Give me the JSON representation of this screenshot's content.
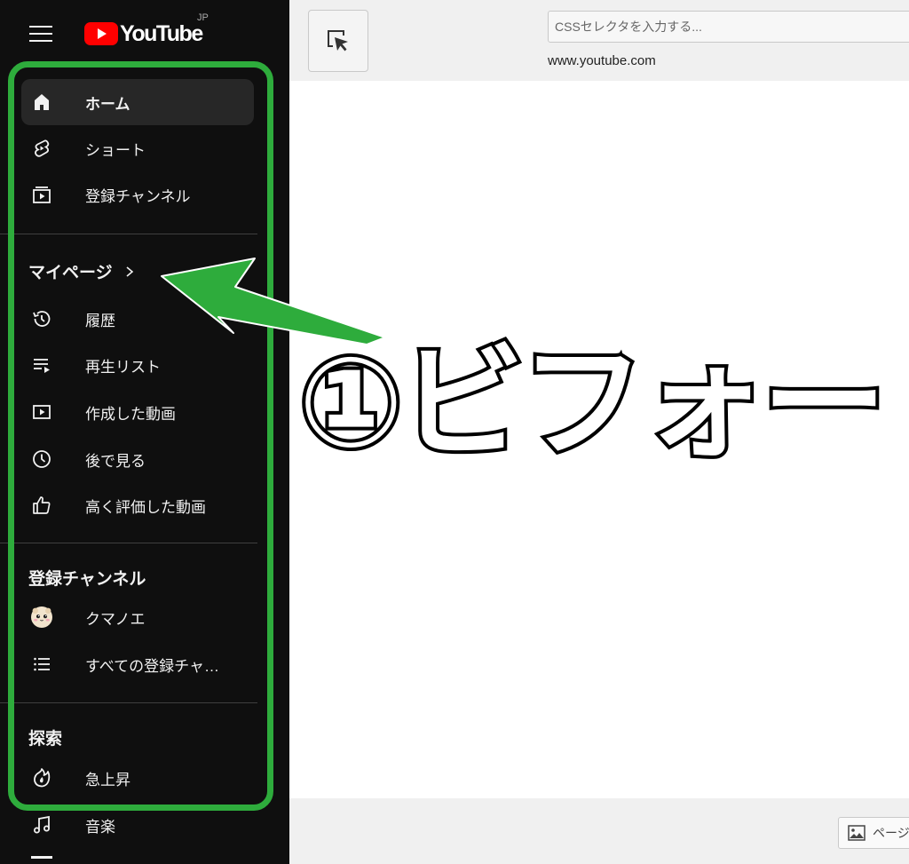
{
  "sidebar": {
    "logo_text": "YouTube",
    "region": "JP",
    "items_main": [
      {
        "label": "ホーム",
        "icon": "home-icon"
      },
      {
        "label": "ショート",
        "icon": "shorts-icon"
      },
      {
        "label": "登録チャンネル",
        "icon": "subscriptions-icon"
      }
    ],
    "mypage_title": "マイページ",
    "items_you": [
      {
        "label": "履歴",
        "icon": "history-icon"
      },
      {
        "label": "再生リスト",
        "icon": "playlist-icon"
      },
      {
        "label": "作成した動画",
        "icon": "your-videos-icon"
      },
      {
        "label": "後で見る",
        "icon": "watch-later-icon"
      },
      {
        "label": "高く評価した動画",
        "icon": "liked-icon"
      }
    ],
    "subscriptions_title": "登録チャンネル",
    "subscriptions": [
      {
        "label": "クマノエ",
        "icon": "channel-avatar"
      },
      {
        "label": "すべての登録チャ…",
        "icon": "list-icon"
      }
    ],
    "explore_title": "探索",
    "explore": [
      {
        "label": "急上昇",
        "icon": "trending-icon"
      },
      {
        "label": "音楽",
        "icon": "music-icon"
      }
    ]
  },
  "toolbar": {
    "css_placeholder": "CSSセレクタを入力する...",
    "url": "www.youtube.com"
  },
  "bottom": {
    "page_button_label": "ページ"
  },
  "annotation": {
    "callout": "①ビフォー",
    "highlight_color": "#2eac3c"
  }
}
